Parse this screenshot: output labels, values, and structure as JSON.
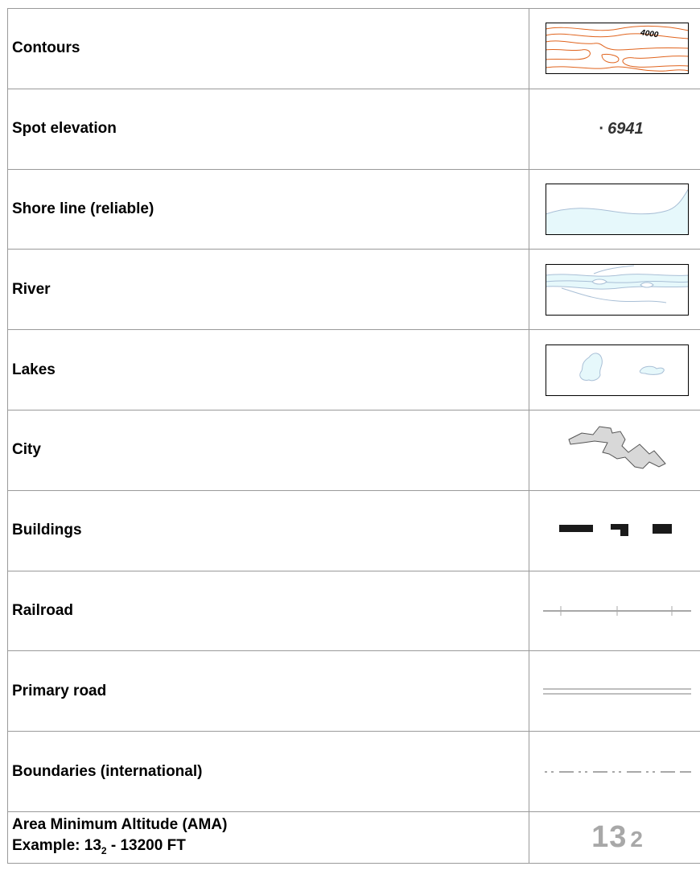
{
  "rows": [
    {
      "label": "Contours",
      "symbol": "contours-symbol",
      "contour_value": "4000"
    },
    {
      "label": "Spot elevation",
      "symbol": "spot-elevation-symbol",
      "value": "6941"
    },
    {
      "label": "Shore line (reliable)",
      "symbol": "shoreline-symbol"
    },
    {
      "label": "River",
      "symbol": "river-symbol"
    },
    {
      "label": "Lakes",
      "symbol": "lakes-symbol"
    },
    {
      "label": "City",
      "symbol": "city-symbol"
    },
    {
      "label": "Buildings",
      "symbol": "buildings-symbol"
    },
    {
      "label": "Railroad",
      "symbol": "railroad-symbol"
    },
    {
      "label": "Primary road",
      "symbol": "primary-road-symbol"
    },
    {
      "label": "Boundaries (international)",
      "symbol": "international-boundary-symbol"
    }
  ],
  "ama": {
    "label_line1": "Area Minimum Altitude (AMA)",
    "label_line2_prefix": "Example: 13",
    "label_line2_sub": "2",
    "label_line2_suffix": " - 13200 FT",
    "value_big": "13",
    "value_small": "2"
  },
  "colors": {
    "contour": "#e0641e",
    "water_fill": "#e6f8fb",
    "water_line": "#a9bfd6",
    "city_fill": "#d8d8d8",
    "building": "#1a1a1a",
    "line_gray": "#a8a8a8"
  }
}
